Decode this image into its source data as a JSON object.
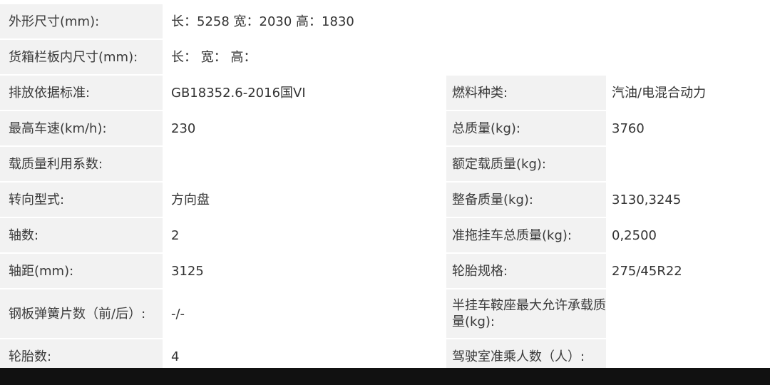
{
  "rows_full": [
    {
      "label": "外形尺寸(mm):",
      "value": "长：5258 宽：2030 高：1830"
    },
    {
      "label": "货箱栏板内尺寸(mm):",
      "value": "长：  宽：  高："
    }
  ],
  "rows_pair": [
    {
      "label": "排放依据标准:",
      "value": "GB18352.6-2016国VI",
      "label2": "燃料种类:",
      "value2": "汽油/电混合动力"
    },
    {
      "label": "最高车速(km/h):",
      "value": "230",
      "label2": "总质量(kg):",
      "value2": "3760"
    },
    {
      "label": "载质量利用系数:",
      "value": "",
      "label2": "额定载质量(kg):",
      "value2": ""
    },
    {
      "label": "转向型式:",
      "value": "方向盘",
      "label2": "整备质量(kg):",
      "value2": "3130,3245"
    },
    {
      "label": "轴数:",
      "value": "2",
      "label2": "准拖挂车总质量(kg):",
      "value2": "0,2500"
    },
    {
      "label": "轴距(mm):",
      "value": "3125",
      "label2": "轮胎规格:",
      "value2": "275/45R22"
    },
    {
      "label": "钢板弹簧片数（前/后）:",
      "value": "-/-",
      "label2": "半挂车鞍座最大允许承载质量(kg):",
      "value2": ""
    },
    {
      "label": "轮胎数:",
      "value": "4",
      "label2": "驾驶室准乘人数（人）:",
      "value2": ""
    }
  ]
}
